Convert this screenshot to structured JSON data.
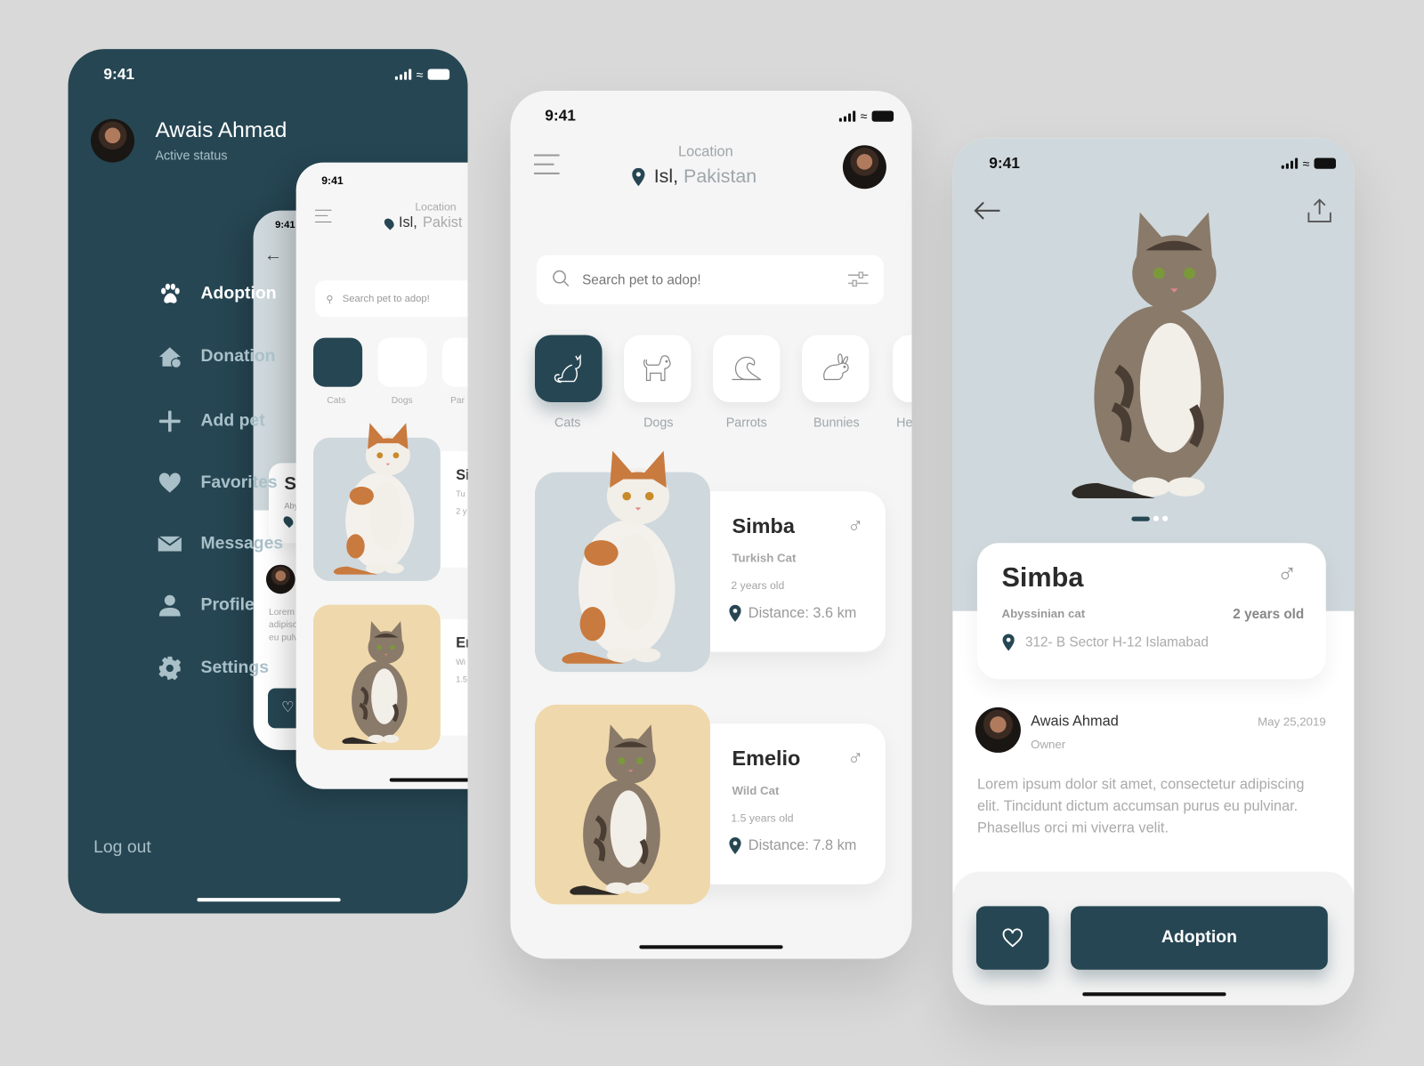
{
  "colors": {
    "primary": "#264653",
    "background": "#d9d9d9",
    "pet_bg_grey": "#cfd8dc",
    "pet_bg_yellow": "#efd8ab"
  },
  "status_time": "9:41",
  "drawer": {
    "user_name": "Awais Ahmad",
    "user_status": "Active status",
    "items": [
      {
        "label": "Adoption",
        "icon": "paw-icon",
        "active": true
      },
      {
        "label": "Donation",
        "icon": "donation-house-icon"
      },
      {
        "label": "Add pet",
        "icon": "plus-icon"
      },
      {
        "label": "Favorites",
        "icon": "heart-icon"
      },
      {
        "label": "Messages",
        "icon": "envelope-icon"
      },
      {
        "label": "Profile",
        "icon": "user-icon"
      },
      {
        "label": "Settings",
        "icon": "gear-icon"
      }
    ],
    "logout": "Log out",
    "mini_back": {
      "name": "S",
      "breed": "Aby",
      "lorem": [
        "Lorem",
        "adipisc",
        "eu pulv"
      ]
    },
    "mini_front": {
      "location_label": "Location",
      "city": "Isl,",
      "country": "Pakist",
      "search": "Search pet to adop!",
      "cats": [
        "Cats",
        "Dogs",
        "Par"
      ],
      "card1": [
        "Si",
        "Tu",
        "2 y"
      ],
      "card2": [
        "Er",
        "Wi",
        "1.5"
      ]
    }
  },
  "home": {
    "location_label": "Location",
    "city": "Isl,",
    "country": "Pakistan",
    "search_placeholder": "Search pet to adop!",
    "categories": [
      {
        "label": "Cats",
        "icon": "cat-icon",
        "active": true
      },
      {
        "label": "Dogs",
        "icon": "dog-icon"
      },
      {
        "label": "Parrots",
        "icon": "parrot-icon"
      },
      {
        "label": "Bunnies",
        "icon": "bunny-icon"
      },
      {
        "label": "He"
      }
    ],
    "pets": [
      {
        "name": "Simba",
        "breed": "Turkish Cat",
        "age": "2 years old",
        "distance": "Distance: 3.6 km",
        "gender": "male"
      },
      {
        "name": "Emelio",
        "breed": "Wild Cat",
        "age": "1.5 years old",
        "distance": "Distance: 7.8 km",
        "gender": "male"
      }
    ]
  },
  "detail": {
    "name": "Simba",
    "breed": "Abyssinian cat",
    "age": "2 years old",
    "address": "312- B Sector H-12 Islamabad",
    "gender": "male",
    "carousel": {
      "count": 3,
      "active": 1
    },
    "owner": {
      "name": "Awais Ahmad",
      "role": "Owner",
      "date": "May 25,2019"
    },
    "description": "Lorem ipsum dolor sit amet, consectetur adipiscing elit. Tincidunt dictum accumsan purus eu pulvinar. Phasellus orci mi viverra velit.",
    "adopt_button": "Adoption"
  }
}
